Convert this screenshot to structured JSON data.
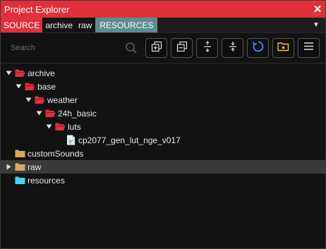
{
  "window": {
    "title": "Project Explorer",
    "close": "✕"
  },
  "tabs": {
    "source": "SOURCE",
    "archive": "archive",
    "raw": "raw",
    "resources": "RESOURCES",
    "dropdown": "▼"
  },
  "search": {
    "placeholder": "Search",
    "value": ""
  },
  "toolbar": {
    "buttons": [
      "expand-all",
      "collapse-all",
      "expand-children",
      "collapse-children",
      "refresh",
      "show-folder",
      "menu"
    ]
  },
  "colors": {
    "accent": "#e0303c",
    "folder_red": "#e0303c",
    "folder_tan": "#d8a85c",
    "folder_cyan": "#3fd7f0",
    "refresh_blue": "#4a8cff",
    "folder_yellow": "#f5c518"
  },
  "tree": [
    {
      "label": "archive",
      "depth": 0,
      "expanded": true,
      "icon": "folder-open-red"
    },
    {
      "label": "base",
      "depth": 1,
      "expanded": true,
      "icon": "folder-open-red"
    },
    {
      "label": "weather",
      "depth": 2,
      "expanded": true,
      "icon": "folder-open-red"
    },
    {
      "label": "24h_basic",
      "depth": 3,
      "expanded": true,
      "icon": "folder-open-red"
    },
    {
      "label": "luts",
      "depth": 4,
      "expanded": true,
      "icon": "folder-open-red"
    },
    {
      "label": "cp2077_gen_lut_nge_v017",
      "depth": 5,
      "icon": "file-icon"
    },
    {
      "label": "customSounds",
      "depth": 0,
      "icon": "folder-tan"
    },
    {
      "label": "raw",
      "depth": 0,
      "collapsed": true,
      "icon": "folder-tan",
      "selected": true
    },
    {
      "label": "resources",
      "depth": 0,
      "icon": "folder-cyan"
    }
  ]
}
